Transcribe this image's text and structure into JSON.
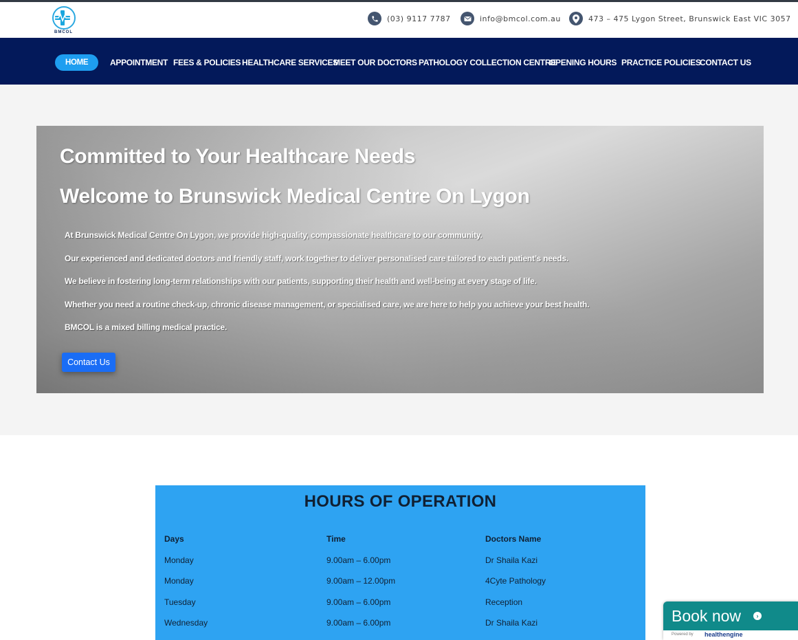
{
  "header": {
    "logo_text": "BMCOL",
    "phone": "(03) 9117 7787",
    "email": "info@bmcol.com.au",
    "address": "473 – 475 Lygon Street, Brunswick East VIC 3057"
  },
  "nav": {
    "items": [
      {
        "label": "HOME"
      },
      {
        "label": "APPOINTMENT"
      },
      {
        "label": "FEES & POLICIES"
      },
      {
        "label": "HEALTHCARE SERVICES"
      },
      {
        "label": "MEET OUR DOCTORS"
      },
      {
        "label": "PATHOLOGY COLLECTION CENTRE"
      },
      {
        "label": "OPENING HOURS"
      },
      {
        "label": "PRACTICE POLICIES"
      },
      {
        "label": "CONTACT US"
      }
    ]
  },
  "hero": {
    "title1": "Committed to Your Healthcare Needs",
    "title2": "Welcome to Brunswick Medical Centre On Lygon",
    "paragraphs": [
      "At Brunswick Medical Centre On Lygon, we provide high-quality, compassionate healthcare to our community.",
      "Our experienced and dedicated doctors and friendly staff, work together to deliver personalised care tailored to each patient’s needs.",
      "We believe in fostering long-term relationships with our patients, supporting their health and well-being at every stage of life.",
      "Whether you need a routine check-up, chronic disease management, or specialised care, we are here to help you achieve your best health.",
      "BMCOL is a mixed billing medical practice."
    ],
    "button": "Contact Us"
  },
  "hours": {
    "title": "HOURS OF OPERATION",
    "headers": [
      "Days",
      "Time",
      "Doctors Name"
    ],
    "rows": [
      [
        "Monday",
        "9.00am – 6.00pm",
        "Dr Shaila Kazi"
      ],
      [
        "Monday",
        "9.00am – 12.00pm",
        "4Cyte Pathology"
      ],
      [
        "Tuesday",
        "9.00am – 6.00pm",
        "Reception"
      ],
      [
        "Wednesday",
        "9.00am – 6.00pm",
        "Dr Shaila Kazi"
      ]
    ]
  },
  "book": {
    "label": "Book now",
    "powered_by": "Powered by",
    "brand": "healthengine"
  },
  "colors": {
    "nav_bg": "#03195a",
    "active_pill": "#1e9ef0",
    "hours_bg": "#2ea3f2",
    "button": "#1a6df5",
    "book_bg": "#108a8a"
  }
}
